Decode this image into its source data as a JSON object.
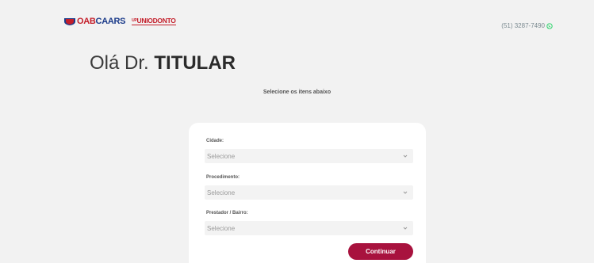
{
  "header": {
    "logo_oab": "OAB",
    "logo_caars": "CAARS",
    "logo_uniodonto": "UNIODONTO",
    "logo_uniodonto_prefix": "UP",
    "contact_phone": "(51) 3287-7490",
    "contact_icon": "whatsapp-icon"
  },
  "greeting": {
    "prefix": "Olá Dr.",
    "name": "TITULAR"
  },
  "instruction": "Selecione os itens abaixo",
  "form": {
    "fields": [
      {
        "label": "Cidade:",
        "value": "Selecione"
      },
      {
        "label": "Procedimento:",
        "value": "Selecione"
      },
      {
        "label": "Prestador / Bairro:",
        "value": "Selecione"
      }
    ],
    "submit_label": "Continuar"
  },
  "colors": {
    "page_background": "#f2f2f2",
    "card_background": "#ffffff",
    "accent_button": "#a8123e",
    "brand_blue": "#1b3b8a",
    "brand_red": "#c41e2a",
    "whatsapp_green": "#25d366"
  }
}
